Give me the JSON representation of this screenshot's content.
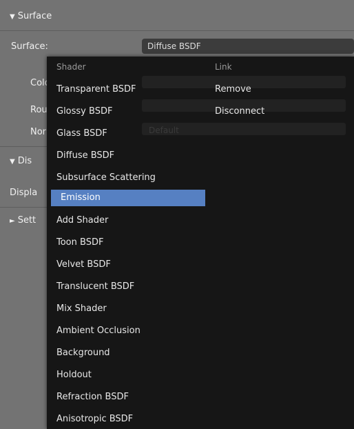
{
  "properties": {
    "surface_section": "Surface",
    "surface_label": "Surface:",
    "surface_value": "Diffuse BSDF",
    "color_label_partial": "Colo",
    "roughness_label_partial": "Rou",
    "normal_label_partial": "Nor",
    "normal_value": "Default",
    "displacement_section_partial": "Dis",
    "displacement_label_partial": "Displa",
    "settings_section_partial": "Sett"
  },
  "menu": {
    "shader_header": "Shader",
    "link_header": "Link",
    "shader_items": [
      "Transparent BSDF",
      "Glossy BSDF",
      "Glass BSDF",
      "Diffuse BSDF",
      "Subsurface Scattering",
      "Emission",
      "Add Shader",
      "Toon BSDF",
      "Velvet BSDF",
      "Translucent BSDF",
      "Mix Shader",
      "Ambient Occlusion",
      "Background",
      "Holdout",
      "Refraction BSDF",
      "Anisotropic BSDF"
    ],
    "link_items": [
      "Remove",
      "Disconnect"
    ],
    "selected_item": "Emission",
    "selection_color": "#5680c2"
  }
}
